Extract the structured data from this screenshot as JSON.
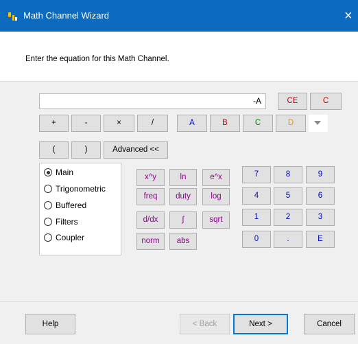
{
  "window": {
    "title": "Math Channel Wizard",
    "close_glyph": "×"
  },
  "instruction": "Enter the equation for this Math Channel.",
  "equation": {
    "value": "-A"
  },
  "clear": {
    "ce": "CE",
    "c": "C"
  },
  "operators": {
    "plus": "+",
    "minus": "-",
    "multiply": "×",
    "divide": "/",
    "open_paren": "(",
    "close_paren": ")",
    "advanced": "Advanced <<"
  },
  "channels": {
    "a": "A",
    "b": "B",
    "c": "C",
    "d": "D"
  },
  "categories": [
    {
      "label": "Main",
      "selected": true
    },
    {
      "label": "Trigonometric",
      "selected": false
    },
    {
      "label": "Buffered",
      "selected": false
    },
    {
      "label": "Filters",
      "selected": false
    },
    {
      "label": "Coupler",
      "selected": false
    }
  ],
  "functions": {
    "xy": "x^y",
    "ln": "ln",
    "ex": "e^x",
    "freq": "freq",
    "duty": "duty",
    "log": "log",
    "ddx": "d/dx",
    "integral": "∫",
    "sqrt": "sqrt",
    "norm": "norm",
    "abs": "abs"
  },
  "keypad": {
    "k7": "7",
    "k8": "8",
    "k9": "9",
    "k4": "4",
    "k5": "5",
    "k6": "6",
    "k1": "1",
    "k2": "2",
    "k3": "3",
    "k0": "0",
    "dot": ".",
    "e": "E"
  },
  "footer": {
    "help": "Help",
    "back": "< Back",
    "next": "Next >",
    "cancel": "Cancel"
  },
  "colors": {
    "titlebar": "#0d6bbf",
    "function_text": "#8b008b",
    "keypad_text": "#0000cc",
    "channel_a": "#0000e6",
    "channel_b": "#c00000",
    "channel_c": "#008000",
    "channel_d": "#e69500"
  }
}
